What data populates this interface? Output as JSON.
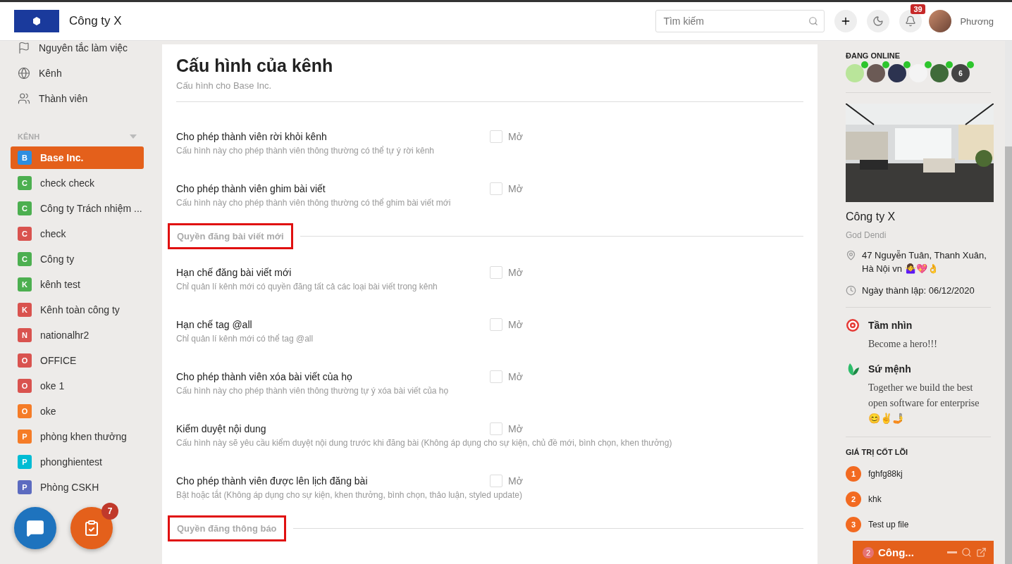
{
  "header": {
    "company": "Công ty X",
    "search": {
      "placeholder": "Tìm kiếm"
    },
    "notifications": "39",
    "user": "Phương"
  },
  "sidebar": {
    "links": [
      {
        "label": "Nguyên tắc làm việc",
        "kind": "flag"
      },
      {
        "label": "Kênh",
        "kind": "globe"
      },
      {
        "label": "Thành viên",
        "kind": "members"
      }
    ],
    "section": "KÊNH",
    "channels": [
      {
        "letter": "B",
        "name": "Base Inc.",
        "color": "#2e8ee0",
        "selected": true
      },
      {
        "letter": "C",
        "name": "check check",
        "color": "#4caf50",
        "selected": false
      },
      {
        "letter": "C",
        "name": "Công ty Trách nhiệm ...",
        "color": "#4caf50",
        "selected": false
      },
      {
        "letter": "C",
        "name": "check",
        "color": "#d9534f",
        "selected": false
      },
      {
        "letter": "C",
        "name": "Công ty",
        "color": "#4caf50",
        "selected": false
      },
      {
        "letter": "K",
        "name": "kênh test",
        "color": "#4caf50",
        "selected": false
      },
      {
        "letter": "K",
        "name": "Kênh toàn công ty",
        "color": "#d9534f",
        "selected": false
      },
      {
        "letter": "N",
        "name": "nationalhr2",
        "color": "#d9534f",
        "selected": false
      },
      {
        "letter": "O",
        "name": "OFFICE",
        "color": "#d9534f",
        "selected": false
      },
      {
        "letter": "O",
        "name": "oke 1",
        "color": "#d9534f",
        "selected": false
      },
      {
        "letter": "O",
        "name": "oke",
        "color": "#f57c27",
        "selected": false
      },
      {
        "letter": "P",
        "name": "phòng khen thưởng",
        "color": "#f57c27",
        "selected": false
      },
      {
        "letter": "P",
        "name": "phonghientest",
        "color": "#00bcd4",
        "selected": false
      },
      {
        "letter": "P",
        "name": "Phòng CSKH",
        "color": "#5c6bc0",
        "selected": false
      }
    ],
    "task_badge": "7"
  },
  "settings": {
    "title": "Cấu hình của kênh",
    "subtitle": "Cấu hình cho Base Inc.",
    "groups": [
      {
        "options": [
          {
            "title": "Cho phép thành viên rời khỏi kênh",
            "description": "Cấu hình này cho phép thành viên thông thường có thể tự ý rời kênh",
            "label": "Mở",
            "checked": false
          },
          {
            "title": "Cho phép thành viên ghim bài viết",
            "description": "Cấu hình này cho phép thành viên thông thường có thể ghim bài viết mới",
            "label": "Mở",
            "checked": false
          }
        ]
      },
      {
        "heading": "Quyền đăng bài viết mới",
        "highlighted": true,
        "options": [
          {
            "title": "Hạn chế đăng bài viết mới",
            "description": "Chỉ quản lí kênh mới có quyền đăng tất cả các loại bài viết trong kênh",
            "label": "Mở",
            "checked": false
          },
          {
            "title": "Hạn chế tag @all",
            "description": "Chỉ quản lí kênh mới có thể tag @all",
            "label": "Mở",
            "checked": false
          },
          {
            "title": "Cho phép thành viên xóa bài viết của họ",
            "description": "Cấu hình này cho phép thành viên thông thường tự ý xóa bài viết của họ",
            "label": "Mở",
            "checked": false
          },
          {
            "title": "Kiểm duyệt nội dung",
            "description": "Cấu hình này sẽ yêu cầu kiểm duyệt nội dung trước khi đăng bài (Không áp dụng cho sự kiện, chủ đề mới, bình chọn, khen thưởng)",
            "label": "Mở",
            "checked": false
          },
          {
            "title": "Cho phép thành viên được lên lịch đăng bài",
            "description": "Bật hoặc tắt (Không áp dụng cho sự kiện, khen thưởng, bình chọn, thảo luận, styled update)",
            "label": "Mở",
            "checked": false
          }
        ]
      },
      {
        "heading": "Quyền đăng thông báo",
        "highlighted": true
      }
    ]
  },
  "info": {
    "online_label": "ĐANG ONLINE",
    "online": [
      {
        "color": "#b9e59a"
      },
      {
        "color": "#6b5a55"
      },
      {
        "color": "#2c3350"
      },
      {
        "color": "#f4f4f4"
      },
      {
        "color": "#3f6b3a"
      }
    ],
    "online_more": "6",
    "name": "Công ty X",
    "owner": "God Dendi",
    "address": "47 Nguyễn Tuân, Thanh Xuân, Hà Nội vn 🤷‍♀️💖👌",
    "founded": "Ngày thành lập: 06/12/2020",
    "vision": {
      "title": "Tầm nhìn",
      "text": "Become a hero!!!"
    },
    "mission": {
      "title": "Sứ mệnh",
      "text": "Together we build the best open software for enterprise 😊✌️🤳"
    },
    "values_label": "GIÁ TRỊ CỐT LÕI",
    "values": [
      {
        "number": "1",
        "text": "fghfg88kj"
      },
      {
        "number": "2",
        "text": "khk"
      },
      {
        "number": "3",
        "text": "Test up file"
      }
    ]
  },
  "chat": {
    "count": "2",
    "title": "Công..."
  }
}
